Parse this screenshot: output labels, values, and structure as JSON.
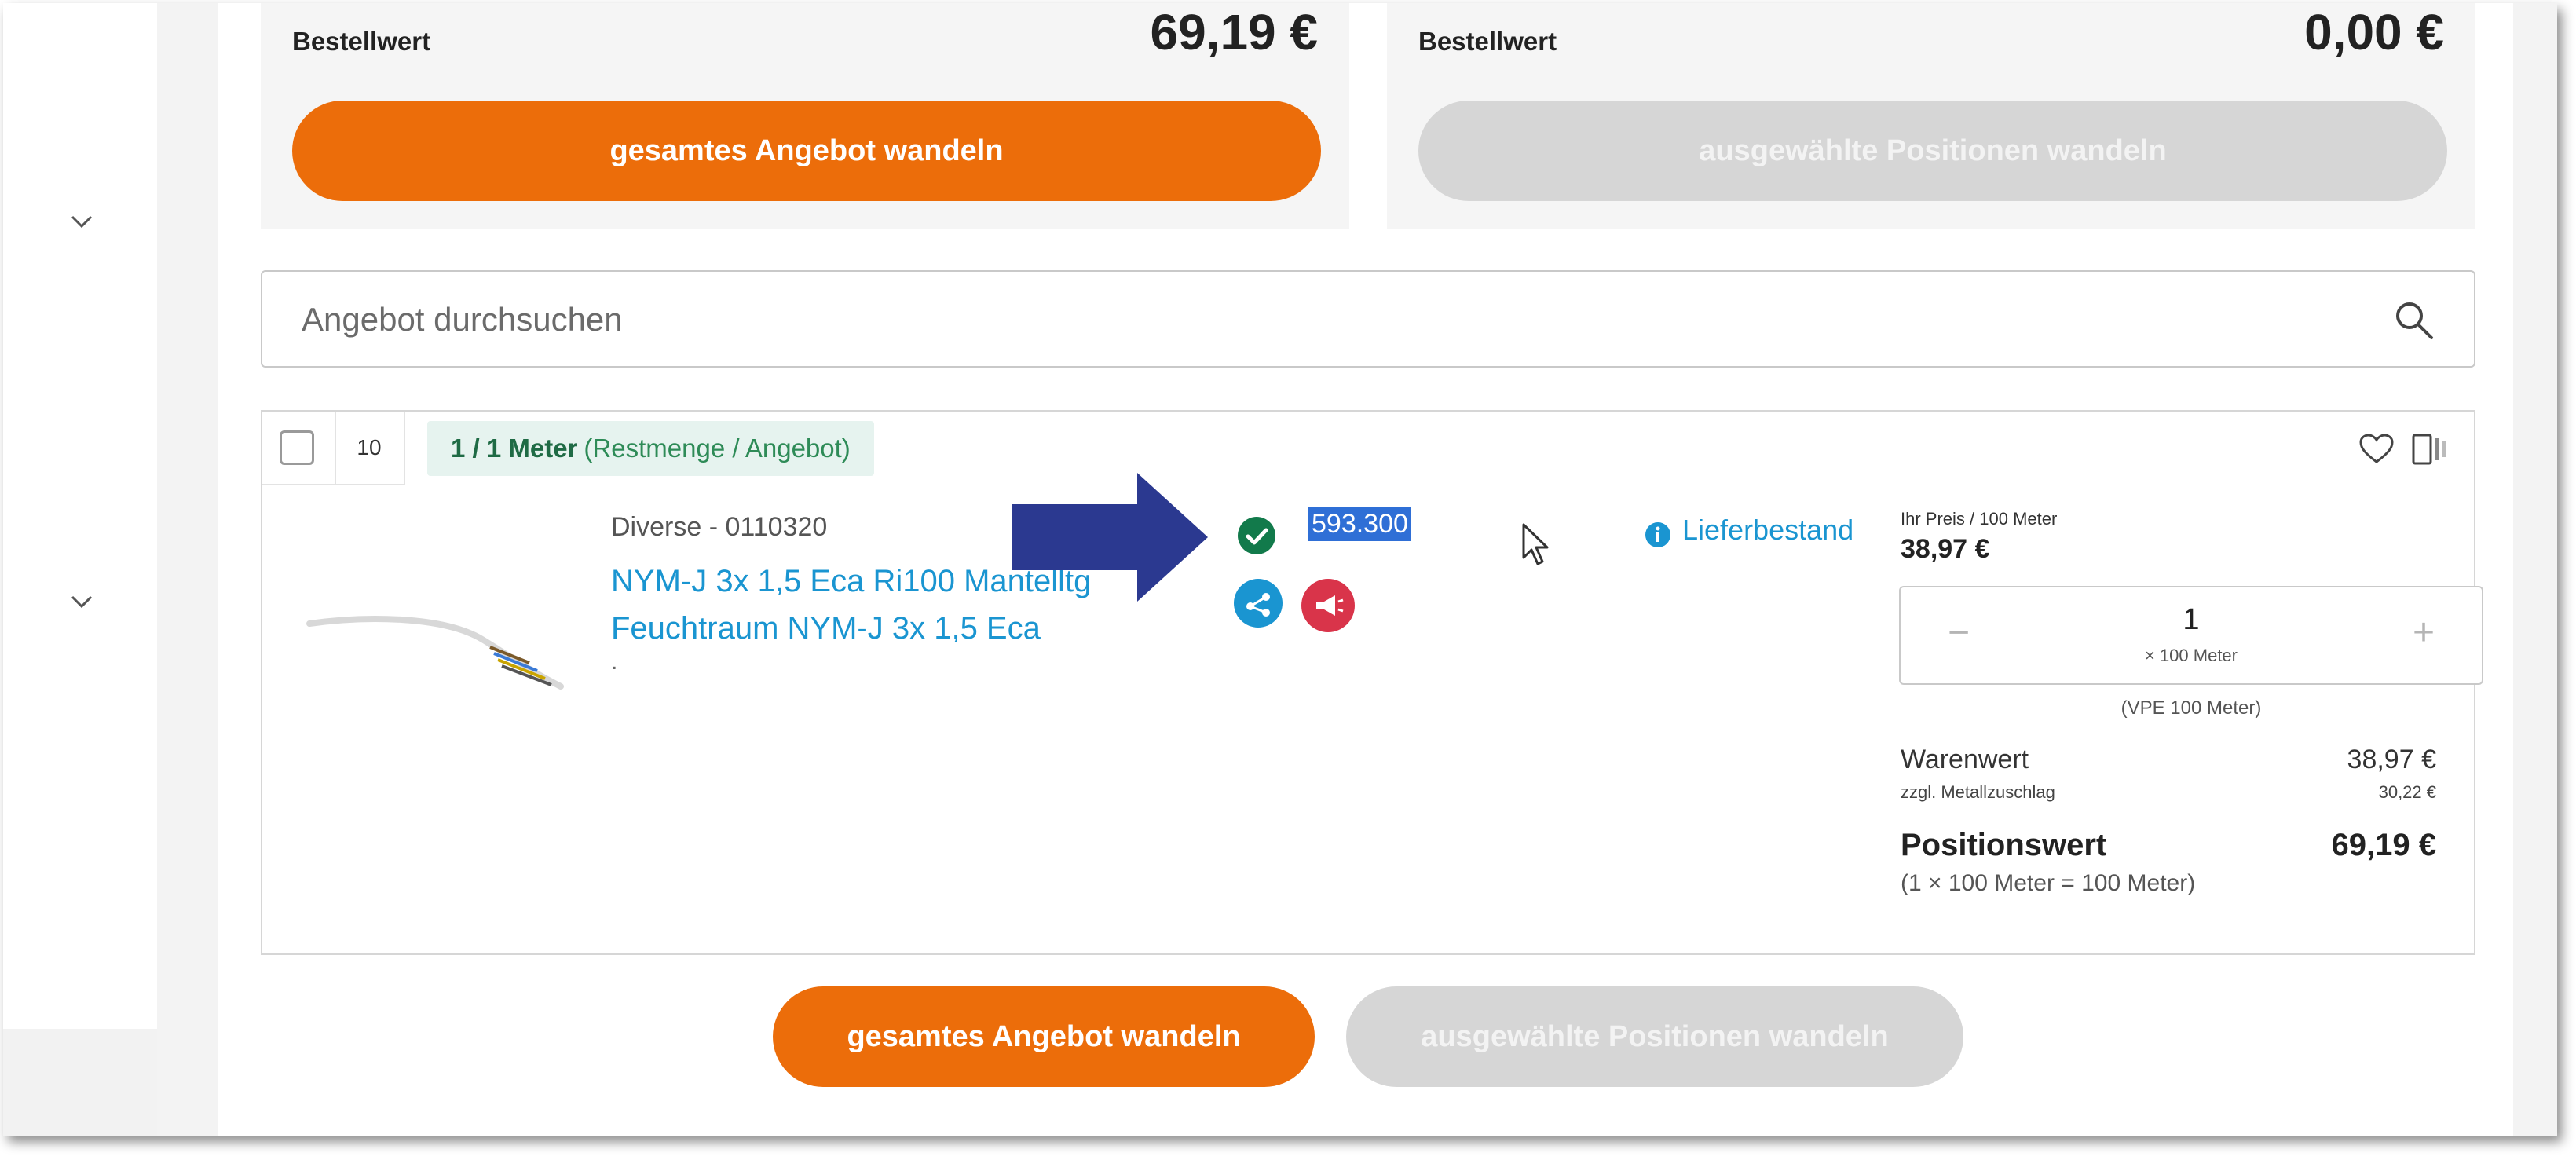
{
  "summary_left": {
    "label": "Bestellwert",
    "value": "69,19 €",
    "button": "gesamtes Angebot wandeln"
  },
  "summary_right": {
    "label": "Bestellwert",
    "value": "0,00 €",
    "button": "ausgewählte Positionen wandeln"
  },
  "search": {
    "placeholder": "Angebot durchsuchen"
  },
  "item": {
    "position": "10",
    "qty_bold": "1 / 1 Meter",
    "qty_note": "(Restmenge / Angebot)",
    "manufacturer": "Diverse - 0110320",
    "title_line1": "NYM-J 3x 1,5 Eca Ri100 Mantelltg",
    "title_line2": "Feuchtraum NYM-J 3x 1,5 Eca",
    "dot": ".",
    "stock_number": "593.300",
    "delivery_label": "Lieferbestand",
    "price_label": "Ihr Preis / 100 Meter",
    "price_value": "38,97 €",
    "stepper": {
      "minus": "−",
      "value": "1",
      "unit": "× 100 Meter",
      "plus": "+"
    },
    "vpe": "(VPE 100 Meter)",
    "warenwert_label": "Warenwert",
    "warenwert_value": "38,97 €",
    "metall_label": "zzgl. Metallzuschlag",
    "metall_value": "30,22 €",
    "positionswert_label": "Positionswert",
    "positionswert_value": "69,19 €",
    "positionswert_detail": "(1 × 100 Meter = 100 Meter)"
  },
  "bottom_buttons": {
    "primary": "gesamtes Angebot wandeln",
    "secondary": "ausgewählte Positionen wandeln"
  },
  "colors": {
    "accent": "#ec6d0a",
    "link": "#1a95d1",
    "success": "#127a4b",
    "promo": "#d9344a",
    "arrow": "#2b3990",
    "disabled": "#d6d6d6"
  }
}
